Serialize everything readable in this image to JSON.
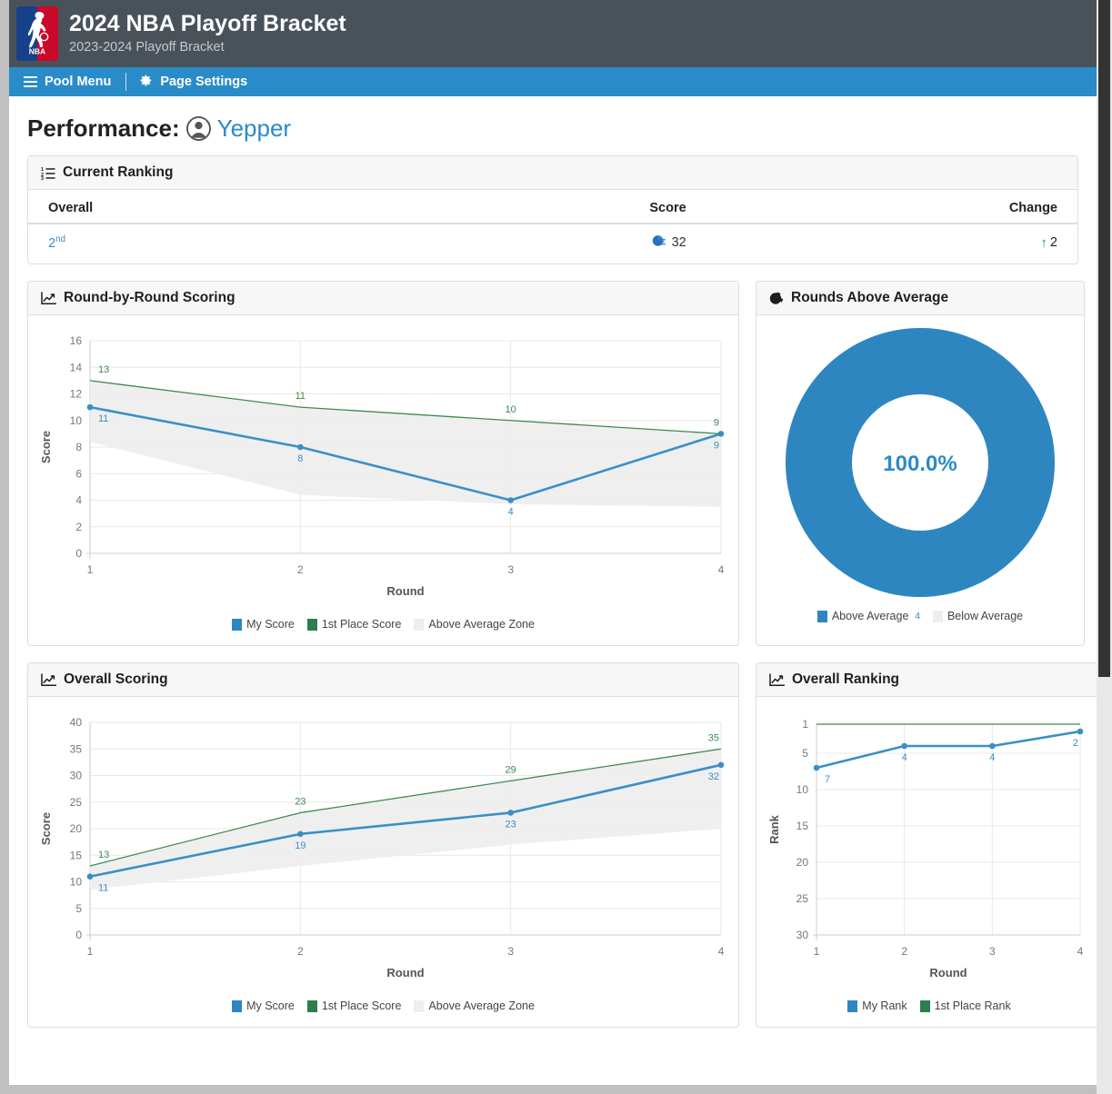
{
  "header": {
    "logo_icon": "nba-logo-icon",
    "title": "2024 NBA Playoff Bracket",
    "subtitle": "2023-2024 Playoff Bracket"
  },
  "navbar": {
    "pool_menu_label": "Pool Menu",
    "page_settings_label": "Page Settings",
    "menu_icon": "hamburger-icon",
    "settings_icon": "gear-icon"
  },
  "page": {
    "heading_label": "Performance:",
    "username": "Yepper",
    "avatar_icon": "user-avatar-icon"
  },
  "ranking_card": {
    "title": "Current Ranking",
    "icon": "list-ordered-icon",
    "columns": [
      "Overall",
      "Score",
      "Change"
    ],
    "row": {
      "overall_value": "2",
      "overall_suffix": "nd",
      "score_icon": "score-chart-icon",
      "score": "32",
      "change_icon": "arrow-up-icon",
      "change": "2"
    }
  },
  "colors": {
    "brand_blue": "#2a8bc9",
    "series_blue": "#3a8fc7",
    "series_green": "#3f8a52",
    "zone_gray": "#eeeeee",
    "header_gray": "#4a5259",
    "up_green": "#1a9a4b"
  },
  "cards": {
    "round_by_round": {
      "title": "Round-by-Round Scoring",
      "icon": "line-chart-icon"
    },
    "rounds_above_average": {
      "title": "Rounds Above Average",
      "icon": "pie-chart-icon"
    },
    "overall_scoring": {
      "title": "Overall Scoring",
      "icon": "line-chart-icon"
    },
    "overall_ranking": {
      "title": "Overall Ranking",
      "icon": "line-chart-icon"
    }
  },
  "chart_data": [
    {
      "id": "round_by_round",
      "type": "line",
      "title": "Round-by-Round Scoring",
      "xlabel": "Round",
      "ylabel": "Score",
      "x": [
        1,
        2,
        3,
        4
      ],
      "xticks": [
        "1",
        "2",
        "3",
        "4"
      ],
      "yticks": [
        "0",
        "2",
        "4",
        "6",
        "8",
        "10",
        "12",
        "14",
        "16"
      ],
      "ylim": [
        0,
        16
      ],
      "grid": true,
      "legend_position": "bottom",
      "series": [
        {
          "name": "My Score",
          "color": "#3a8fc7",
          "values": [
            11,
            8,
            4,
            9
          ],
          "labels": [
            "11",
            "8",
            "4",
            "9"
          ]
        },
        {
          "name": "1st Place Score",
          "color": "#3f8a52",
          "values": [
            13,
            11,
            10,
            9
          ],
          "labels": [
            "13",
            "11",
            "10",
            "9"
          ]
        },
        {
          "name": "Above Average Zone",
          "color": "#eeeeee",
          "band_upper": [
            13,
            11,
            10,
            9
          ],
          "band_lower": [
            8.4,
            4.4,
            3.7,
            3.5
          ]
        }
      ]
    },
    {
      "id": "rounds_above_average",
      "type": "pie",
      "title": "Rounds Above Average",
      "center_label": "100.0%",
      "legend_position": "bottom",
      "slices": [
        {
          "name": "Above Average",
          "value": 4,
          "label": "4",
          "percent": 100.0,
          "color": "#2e86c1"
        },
        {
          "name": "Below Average",
          "value": 0,
          "label": "",
          "percent": 0.0,
          "color": "#eeeeee"
        }
      ]
    },
    {
      "id": "overall_scoring",
      "type": "line",
      "title": "Overall Scoring",
      "xlabel": "Round",
      "ylabel": "Score",
      "x": [
        1,
        2,
        3,
        4
      ],
      "xticks": [
        "1",
        "2",
        "3",
        "4"
      ],
      "yticks": [
        "0",
        "5",
        "10",
        "15",
        "20",
        "25",
        "30",
        "35",
        "40"
      ],
      "ylim": [
        0,
        40
      ],
      "grid": true,
      "legend_position": "bottom",
      "series": [
        {
          "name": "My Score",
          "color": "#3a8fc7",
          "values": [
            11,
            19,
            23,
            32
          ],
          "labels": [
            "11",
            "19",
            "23",
            "32"
          ]
        },
        {
          "name": "1st Place Score",
          "color": "#3f8a52",
          "values": [
            13,
            23,
            29,
            35
          ],
          "labels": [
            "13",
            "23",
            "29",
            "35"
          ]
        },
        {
          "name": "Above Average Zone",
          "color": "#eeeeee",
          "band_upper": [
            13,
            23,
            29,
            35
          ],
          "band_lower": [
            8.5,
            13,
            17,
            20
          ]
        }
      ]
    },
    {
      "id": "overall_ranking",
      "type": "line",
      "title": "Overall Ranking",
      "xlabel": "Round",
      "ylabel": "Rank",
      "x": [
        1,
        2,
        3,
        4
      ],
      "xticks": [
        "1",
        "2",
        "3",
        "4"
      ],
      "yticks": [
        "1",
        "5",
        "10",
        "15",
        "20",
        "25",
        "30"
      ],
      "ylim": [
        1,
        30
      ],
      "y_inverted": true,
      "grid": true,
      "legend_position": "bottom",
      "series": [
        {
          "name": "My Rank",
          "color": "#3a8fc7",
          "values": [
            7,
            4,
            4,
            2
          ],
          "labels": [
            "7",
            "4",
            "4",
            "2"
          ]
        },
        {
          "name": "1st Place Rank",
          "color": "#3f8a52",
          "values": [
            1,
            1,
            1,
            1
          ],
          "labels": []
        }
      ]
    }
  ]
}
